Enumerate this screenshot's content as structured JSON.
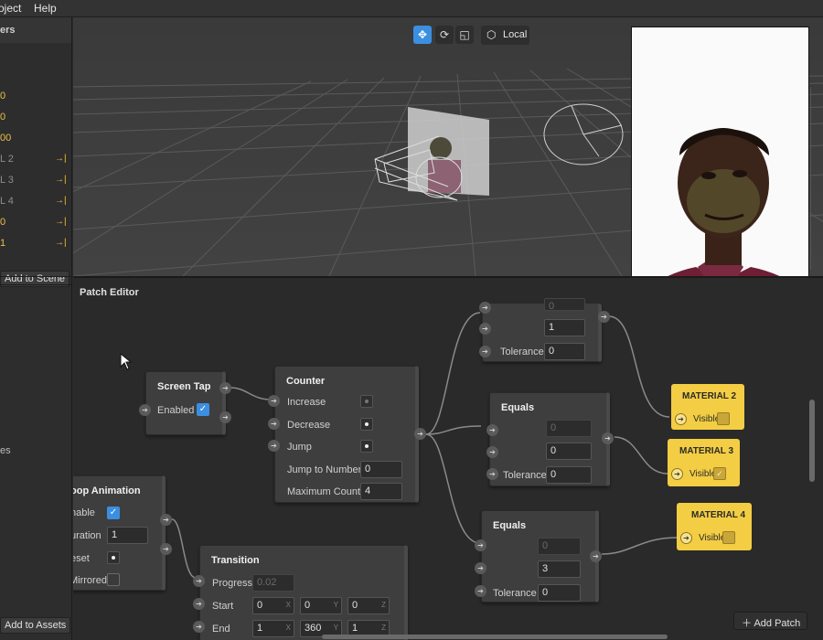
{
  "menu": {
    "items": [
      "oject",
      "Help"
    ]
  },
  "sidebar": {
    "header": "ers",
    "layers": [
      {
        "label": "0",
        "dim": false,
        "arrow": false
      },
      {
        "label": "0",
        "dim": false,
        "arrow": false
      },
      {
        "label": "00",
        "dim": false,
        "arrow": false
      },
      {
        "label": "L 2",
        "dim": true,
        "arrow": true
      },
      {
        "label": "L 3",
        "dim": true,
        "arrow": true
      },
      {
        "label": "L 4",
        "dim": true,
        "arrow": true
      },
      {
        "label": "0",
        "dim": false,
        "arrow": true
      },
      {
        "label": "1",
        "dim": false,
        "arrow": true
      }
    ],
    "arrow_glyph": "→|",
    "add_to_scene": "Add to Scene",
    "assets_partial_label": "es",
    "add_to_assets": "Add to Assets"
  },
  "viewport": {
    "toolbar": {
      "tools": [
        "move-icon",
        "rotate-icon",
        "scale-icon"
      ],
      "active": "move-icon",
      "local_label": "Local"
    }
  },
  "patch_editor": {
    "title": "Patch Editor",
    "add_patch": "Add Patch",
    "screen_tap": {
      "title": "Screen Tap",
      "enabled_label": "Enabled",
      "enabled": true
    },
    "counter": {
      "title": "Counter",
      "increase": "Increase",
      "decrease": "Decrease",
      "jump": "Jump",
      "jump_to_number": "Jump to Number",
      "jump_to_number_value": "0",
      "maximum_count": "Maximum Count",
      "maximum_count_value": "4"
    },
    "equals_top": {
      "top_value": "0",
      "value": "1",
      "tolerance_label": "Tolerance",
      "tolerance": "0"
    },
    "equals_mid": {
      "title": "Equals",
      "top_value": "0",
      "value": "0",
      "tolerance_label": "Tolerance",
      "tolerance": "0"
    },
    "equals_bottom": {
      "title": "Equals",
      "top_value": "0",
      "value": "3",
      "tolerance_label": "Tolerance",
      "tolerance": "0"
    },
    "loop_animation": {
      "title": "oop Animation",
      "enable_label": "nable",
      "enable": true,
      "duration_label": "uration",
      "duration": "1",
      "reset_label": "eset",
      "mirrored_label": "Mirrored"
    },
    "transition": {
      "title": "Transition",
      "progress_label": "Progress",
      "progress": "0.02",
      "start_label": "Start",
      "start": [
        "0",
        "0",
        "0"
      ],
      "end_label": "End",
      "end": [
        "1",
        "360",
        "1"
      ],
      "axes": [
        "X",
        "Y",
        "Z"
      ]
    },
    "materials": [
      {
        "title": "MATERIAL 2",
        "visible_label": "Visible",
        "visible": false
      },
      {
        "title": "MATERIAL 3",
        "visible_label": "Visible",
        "visible": true
      },
      {
        "title": "MATERIAL 4",
        "visible_label": "Visible",
        "visible": false
      }
    ]
  },
  "colors": {
    "accent": "#3b8fe0",
    "patch_yellow": "#f3cd43",
    "layer_text": "#e8c048"
  }
}
